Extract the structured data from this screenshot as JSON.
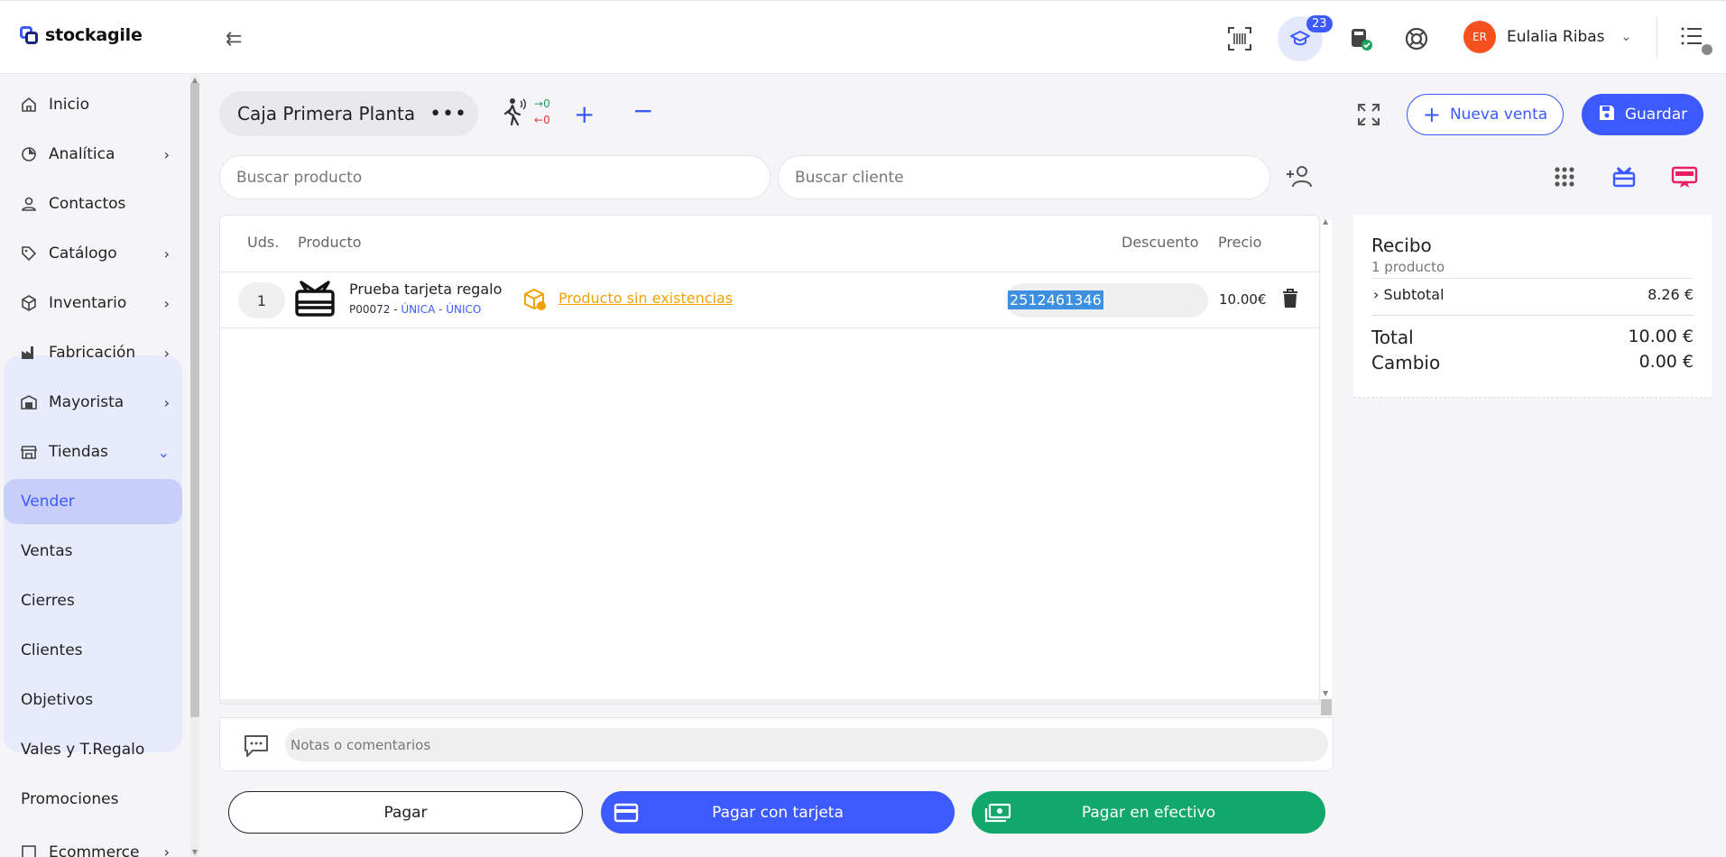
{
  "app": {
    "logo_text": "stockagile"
  },
  "topbar": {
    "academy_badge": "23",
    "user_initials": "ER",
    "user_name": "Eulalia Ribas"
  },
  "sidebar": {
    "items": [
      {
        "label": "Inicio",
        "icon": "home-icon"
      },
      {
        "label": "Analítica",
        "icon": "analytics-icon"
      },
      {
        "label": "Contactos",
        "icon": "person-icon"
      },
      {
        "label": "Catálogo",
        "icon": "tag-icon"
      },
      {
        "label": "Inventario",
        "icon": "box-icon"
      },
      {
        "label": "Fabricación",
        "icon": "factory-icon"
      },
      {
        "label": "Mayorista",
        "icon": "warehouse-icon"
      },
      {
        "label": "Tiendas",
        "icon": "store-icon"
      }
    ],
    "tiendas_sub": [
      "Vender",
      "Ventas",
      "Cierres",
      "Clientes",
      "Objetivos",
      "Vales y T.Regalo",
      "Promociones"
    ],
    "next_item": "Ecommerce"
  },
  "pos": {
    "register_name": "Caja Primera Planta",
    "traffic_in": "0",
    "traffic_out": "0",
    "new_sale_label": "Nueva venta",
    "save_label": "Guardar",
    "search_product_placeholder": "Buscar producto",
    "search_client_placeholder": "Buscar cliente"
  },
  "table": {
    "headers": {
      "units": "Uds.",
      "product": "Producto",
      "discount": "Descuento",
      "price": "Precio"
    },
    "rows": [
      {
        "qty": "1",
        "name": "Prueba tarjeta regalo",
        "ref": "P00072",
        "variant": "ÚNICA - ÚNICO",
        "stock_warning": "Producto sin existencias",
        "discount": "2512461346",
        "price": "10.00€"
      }
    ]
  },
  "notes": {
    "placeholder": "Notas o comentarios"
  },
  "payment": {
    "pay_label": "Pagar",
    "card_label": "Pagar con tarjeta",
    "cash_label": "Pagar en efectivo"
  },
  "receipt": {
    "title": "Recibo",
    "count": "1 producto",
    "subtotal_label": "Subtotal",
    "subtotal_value": "8.26 €",
    "total_label": "Total",
    "total_value": "10.00 €",
    "change_label": "Cambio",
    "change_value": "0.00 €"
  },
  "colors": {
    "accent": "#3d5afe",
    "cash": "#12a86b",
    "warning": "#f0a202",
    "avatar": "#f4511e"
  }
}
